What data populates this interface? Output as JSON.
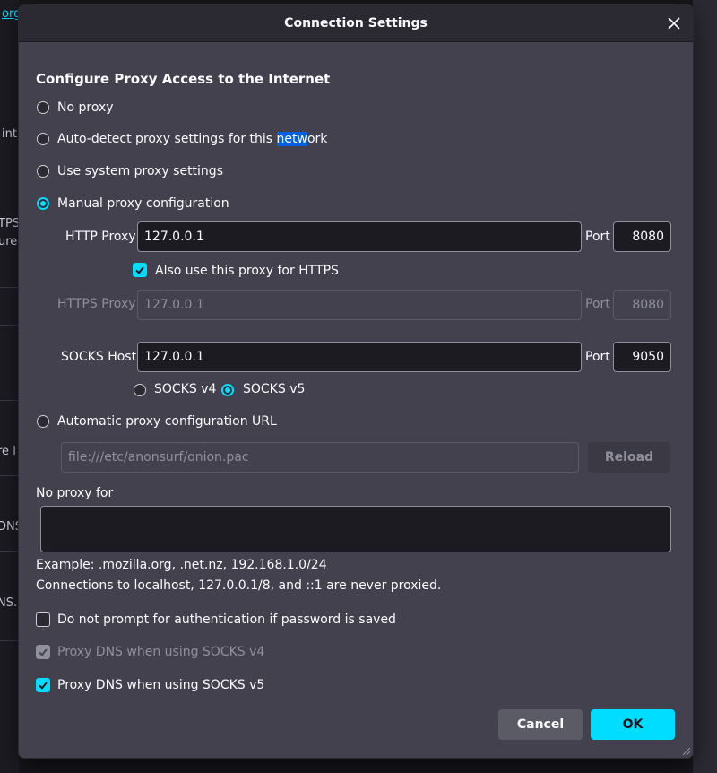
{
  "background": {
    "link_fragment": "org",
    "fragments": [
      "int",
      "TPS",
      "ure",
      "re l",
      "DNS",
      "NS."
    ]
  },
  "dialog": {
    "title": "Connection Settings",
    "heading": "Configure Proxy Access to the Internet",
    "options": {
      "no_proxy": "No proxy",
      "auto_detect_a": "Auto-detect proxy settings for this ",
      "auto_detect_sel": "netw",
      "auto_detect_b": "ork",
      "system": "Use system proxy settings",
      "manual": "Manual proxy configuration",
      "auto_url": "Automatic proxy configuration URL"
    },
    "http_proxy": {
      "label": "HTTP Proxy",
      "value": "127.0.0.1",
      "port_label": "Port",
      "port": "8080"
    },
    "also_https": "Also use this proxy for HTTPS",
    "https_proxy": {
      "label": "HTTPS Proxy",
      "value": "127.0.0.1",
      "port_label": "Port",
      "port": "8080"
    },
    "socks": {
      "label": "SOCKS Host",
      "value": "127.0.0.1",
      "port_label": "Port",
      "port": "9050",
      "v4": "SOCKS v4",
      "v5": "SOCKS v5"
    },
    "pac_url": "file:///etc/anonsurf/onion.pac",
    "reload": "Reload",
    "no_proxy_for": "No proxy for",
    "no_proxy_value": "",
    "example": "Example: .mozilla.org, .net.nz, 192.168.1.0/24",
    "localhost_note": "Connections to localhost, 127.0.0.1/8, and ::1 are never proxied.",
    "no_auth_prompt": "Do not prompt for authentication if password is saved",
    "dns_v4": "Proxy DNS when using SOCKS v4",
    "dns_v5": "Proxy DNS when using SOCKS v5",
    "cancel": "Cancel",
    "ok": "OK"
  },
  "colors": {
    "accent": "#00ddff",
    "dialog_bg": "#42414d",
    "titlebar_bg": "#2b2a33",
    "field_bg": "#1c1b22"
  }
}
